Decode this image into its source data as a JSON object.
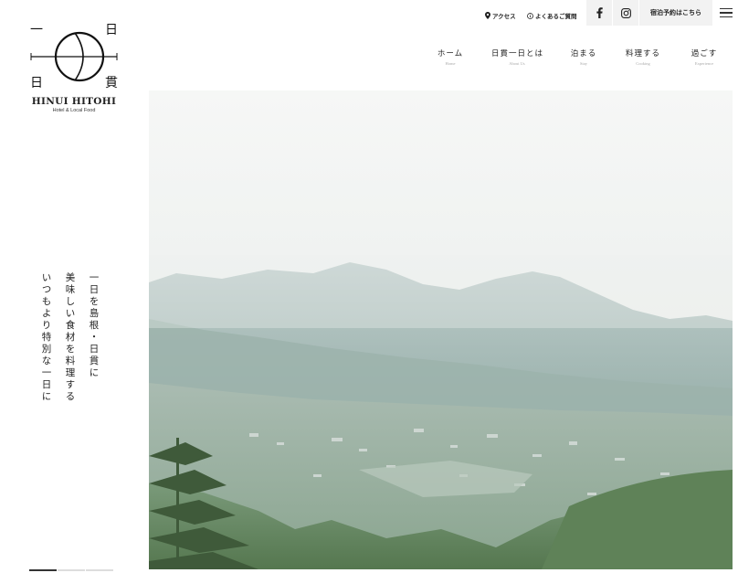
{
  "logo": {
    "kanji_top_left": "一",
    "kanji_top_right": "日",
    "kanji_bottom_left": "日",
    "kanji_bottom_right": "貫",
    "name": "HINUI HITOHI",
    "subtitle": "Hotel & Local Food"
  },
  "utility": {
    "access_label": "アクセス",
    "faq_label": "よくあるご質問",
    "reserve_label": "宿泊予約はこちら"
  },
  "nav": {
    "items": [
      {
        "jp": "ホーム",
        "en": "Home"
      },
      {
        "jp": "日貫一日とは",
        "en": "About Us"
      },
      {
        "jp": "泊まる",
        "en": "Stay"
      },
      {
        "jp": "料理する",
        "en": "Cooking"
      },
      {
        "jp": "過ごす",
        "en": "Experience"
      }
    ]
  },
  "tagline": {
    "line1": "一日を島根・日貫に",
    "line2": "美味しい食材を料理する",
    "line3": "いつもより特別な一日に"
  },
  "slider": {
    "count": 3,
    "active_index": 0
  },
  "icons": {
    "access": "map-pin-icon",
    "faq": "info-circle-icon",
    "facebook": "facebook-icon",
    "instagram": "instagram-icon",
    "menu": "hamburger-menu-icon"
  }
}
